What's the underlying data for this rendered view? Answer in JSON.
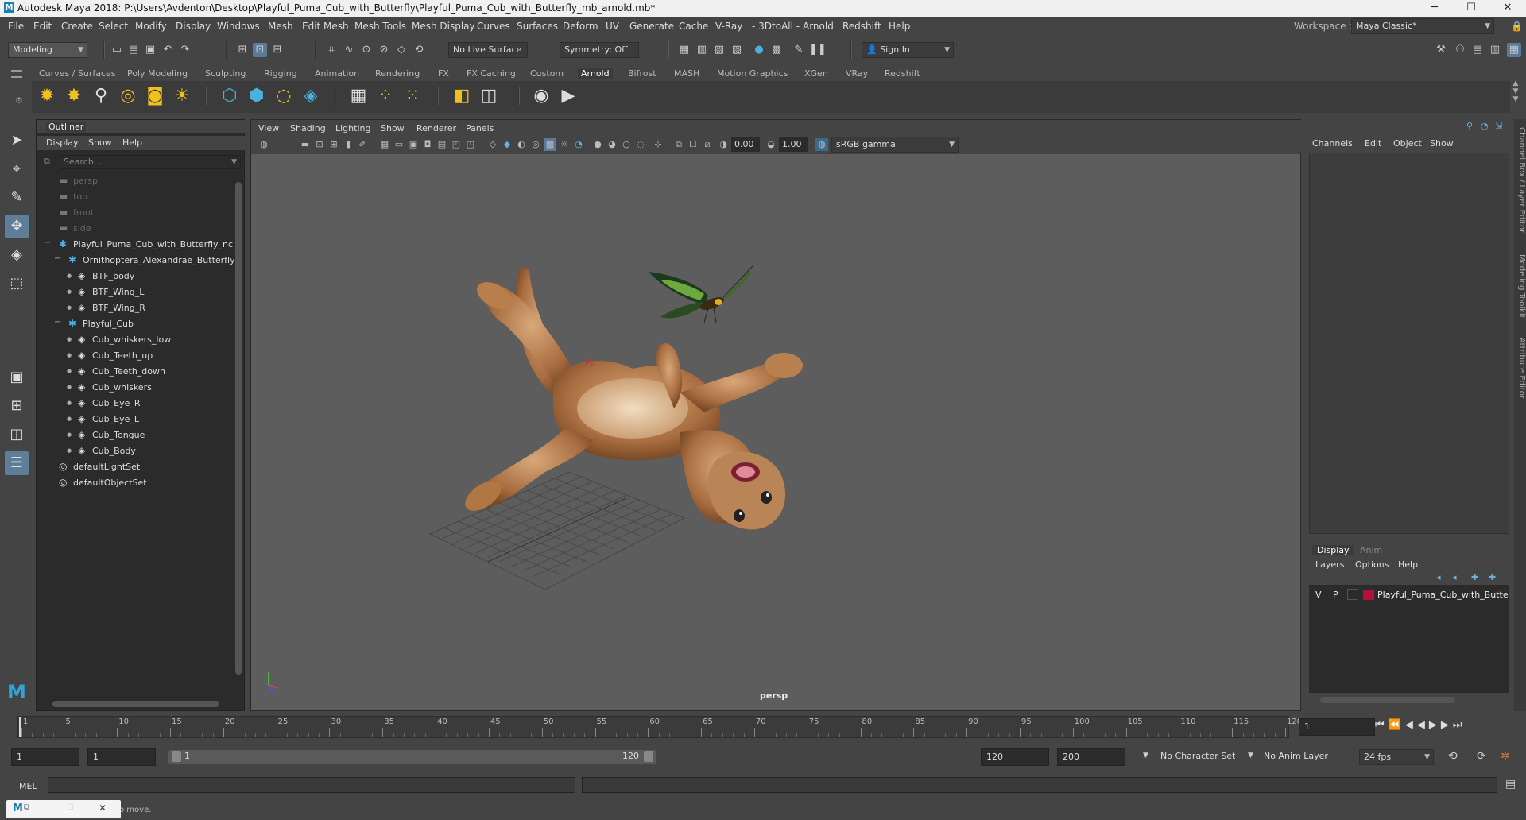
{
  "window": {
    "title": "Autodesk Maya 2018: P:\\Users\\Avdenton\\Desktop\\Playful_Puma_Cub_with_Butterfly\\Playful_Puma_Cub_with_Butterfly_mb_arnold.mb*",
    "logo_letter": "M",
    "minimize": "─",
    "maximize": "☐",
    "close": "✕"
  },
  "menubar": {
    "items": [
      "File",
      "Edit",
      "Create",
      "Select",
      "Modify",
      "Display",
      "Windows",
      "Mesh",
      "Edit Mesh",
      "Mesh Tools",
      "Mesh Display",
      "Curves",
      "Surfaces",
      "Deform",
      "UV",
      "Generate",
      "Cache",
      "V-Ray",
      "- 3DtoAll -",
      "Arnold",
      "Redshift",
      "Help"
    ],
    "workspace_label": "Workspace :",
    "workspace_value": "Maya Classic*"
  },
  "statusline": {
    "mode": "Modeling",
    "live_surface": "No Live Surface",
    "symmetry": "Symmetry: Off",
    "sign_in": "Sign In"
  },
  "shelf": {
    "tabs": [
      "Curves / Surfaces",
      "Poly Modeling",
      "Sculpting",
      "Rigging",
      "Animation",
      "Rendering",
      "FX",
      "FX Caching",
      "Custom",
      "Arnold",
      "Bifrost",
      "MASH",
      "Motion Graphics",
      "XGen",
      "VRay",
      "Redshift"
    ],
    "active_tab": "Arnold"
  },
  "outliner": {
    "title": "Outliner",
    "menu": [
      "Display",
      "Show",
      "Help"
    ],
    "search_placeholder": "Search...",
    "rows": [
      {
        "label": "persp",
        "indent": 0,
        "icon": "camera-icon",
        "dim": true
      },
      {
        "label": "top",
        "indent": 0,
        "icon": "camera-icon",
        "dim": true
      },
      {
        "label": "front",
        "indent": 0,
        "icon": "camera-icon",
        "dim": true
      },
      {
        "label": "side",
        "indent": 0,
        "icon": "camera-icon",
        "dim": true
      },
      {
        "label": "Playful_Puma_Cub_with_Butterfly_ncl",
        "indent": 0,
        "icon": "group-icon",
        "expand": "−"
      },
      {
        "label": "Ornithoptera_Alexandrae_Butterfly",
        "indent": 1,
        "icon": "group-icon",
        "expand": "−"
      },
      {
        "label": "BTF_body",
        "indent": 2,
        "icon": "mesh-icon"
      },
      {
        "label": "BTF_Wing_L",
        "indent": 2,
        "icon": "mesh-icon"
      },
      {
        "label": "BTF_Wing_R",
        "indent": 2,
        "icon": "mesh-icon"
      },
      {
        "label": "Playful_Cub",
        "indent": 1,
        "icon": "group-icon",
        "expand": "−"
      },
      {
        "label": "Cub_whiskers_low",
        "indent": 2,
        "icon": "mesh-icon"
      },
      {
        "label": "Cub_Teeth_up",
        "indent": 2,
        "icon": "mesh-icon"
      },
      {
        "label": "Cub_Teeth_down",
        "indent": 2,
        "icon": "mesh-icon"
      },
      {
        "label": "Cub_whiskers",
        "indent": 2,
        "icon": "mesh-icon"
      },
      {
        "label": "Cub_Eye_R",
        "indent": 2,
        "icon": "mesh-icon"
      },
      {
        "label": "Cub_Eye_L",
        "indent": 2,
        "icon": "mesh-icon"
      },
      {
        "label": "Cub_Tongue",
        "indent": 2,
        "icon": "mesh-icon"
      },
      {
        "label": "Cub_Body",
        "indent": 2,
        "icon": "mesh-icon"
      },
      {
        "label": "defaultLightSet",
        "indent": 0,
        "icon": "set-icon"
      },
      {
        "label": "defaultObjectSet",
        "indent": 0,
        "icon": "set-icon"
      }
    ]
  },
  "viewport": {
    "menu": [
      "View",
      "Shading",
      "Lighting",
      "Show",
      "Renderer",
      "Panels"
    ],
    "exposure": "0.00",
    "gamma": "1.00",
    "color_space": "sRGB gamma",
    "camera": "persp"
  },
  "channelbox": {
    "menu": [
      "Channels",
      "Edit",
      "Object",
      "Show"
    ],
    "layer_tabs": [
      "Display",
      "Anim"
    ],
    "layer_menu": [
      "Layers",
      "Options",
      "Help"
    ],
    "layer": {
      "v": "V",
      "p": "P",
      "name": "Playful_Puma_Cub_with_Butte",
      "color": "#b0103a"
    },
    "side_tabs": [
      "Channel Box / Layer Editor",
      "Modeling Toolkit",
      "Attribute Editor"
    ]
  },
  "timeline": {
    "ticks": [
      "1",
      "5",
      "10",
      "15",
      "20",
      "25",
      "30",
      "35",
      "40",
      "45",
      "50",
      "55",
      "60",
      "65",
      "70",
      "75",
      "80",
      "85",
      "90",
      "95",
      "100",
      "105",
      "110",
      "115",
      "120"
    ],
    "current_frame": "1",
    "range_start": "1",
    "range_start_inner": "1",
    "range_slider_start": "1",
    "range_slider_end": "120",
    "range_end": "120",
    "anim_end": "200",
    "character_set": "No Character Set",
    "anim_layer": "No Anim Layer",
    "fps": "24 fps"
  },
  "cmdline": {
    "label": "MEL"
  },
  "helpline": {
    "text": "o move."
  }
}
